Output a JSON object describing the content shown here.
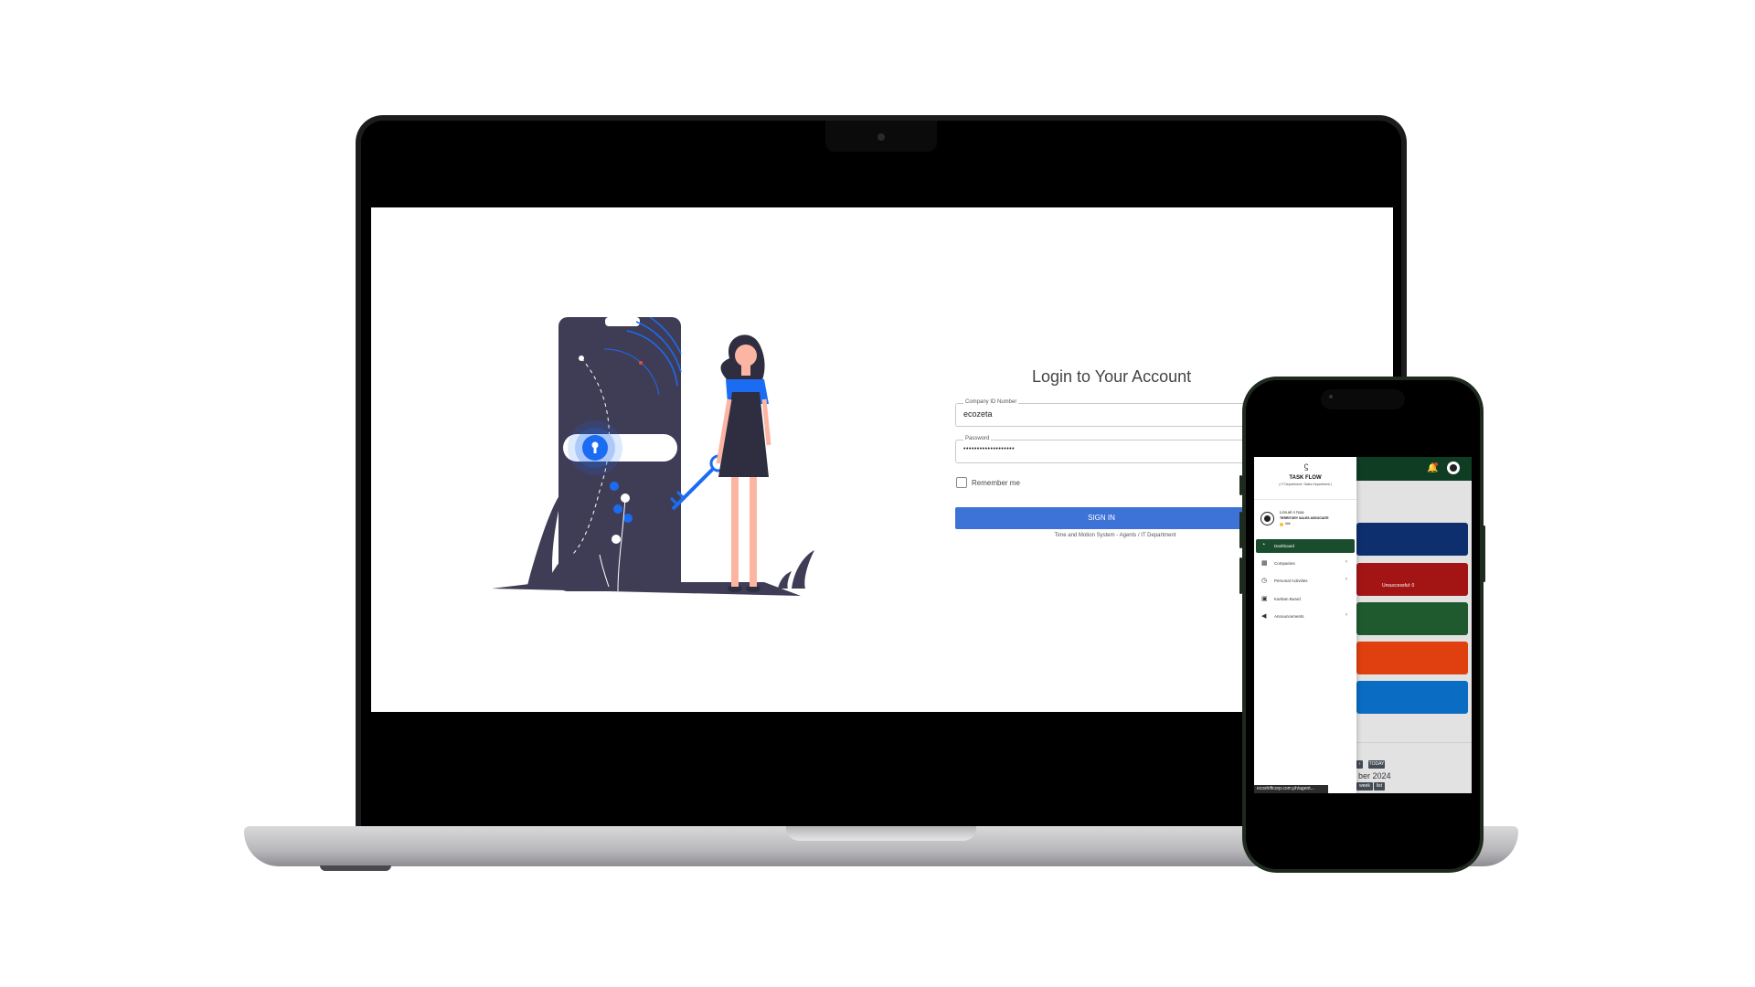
{
  "login": {
    "title": "Login to Your Account",
    "company_id_label": "Company ID Number",
    "company_id_value": "ecozeta",
    "password_label": "Password",
    "password_value": "•••••••••••••••••••",
    "remember_label": "Remember me",
    "signin_label": "SIGN IN",
    "footnote": "Time and Motion System - Agents / IT Department"
  },
  "mobile": {
    "brand": "TASK FLOW",
    "brand_sub": "( IT Department / Sales Department )",
    "user_name": "Limuel A Naa",
    "user_role": "TERRITORY SALES ASSOCIATE",
    "status": "Idle",
    "nav": [
      {
        "label": "Dashboard",
        "icon": "dashboard-icon",
        "active": true
      },
      {
        "label": "Companies",
        "icon": "building-icon",
        "chevron": "‹"
      },
      {
        "label": "Personal Activities",
        "icon": "clock-icon",
        "chevron": "‹"
      },
      {
        "label": "Kanban Board",
        "icon": "board-icon"
      },
      {
        "label": "Announcements",
        "icon": "megaphone-icon",
        "chevron": "‹"
      }
    ],
    "cards": [
      {
        "color": "#0d2f6e",
        "text": ""
      },
      {
        "color": "#a31515",
        "text": "Unsuccessful: 0"
      },
      {
        "color": "#1f5a2e",
        "text": ""
      },
      {
        "color": "#e0400f",
        "text": ""
      },
      {
        "color": "#0a6cc2",
        "text": ""
      }
    ],
    "calendar": {
      "next_label": "›",
      "today_label": "TODAY",
      "month_label": "ber 2024",
      "week_label": "week",
      "list_label": "list"
    },
    "url_tooltip": "ecoshiftcorp.com.ph/agent..."
  },
  "colors": {
    "primary_button": "#3d73d6",
    "sidebar_active": "#1a4d2e",
    "topbar": "#0f3d24",
    "illustration_dark": "#3f3d56",
    "illustration_accent": "#1b6cf2"
  }
}
